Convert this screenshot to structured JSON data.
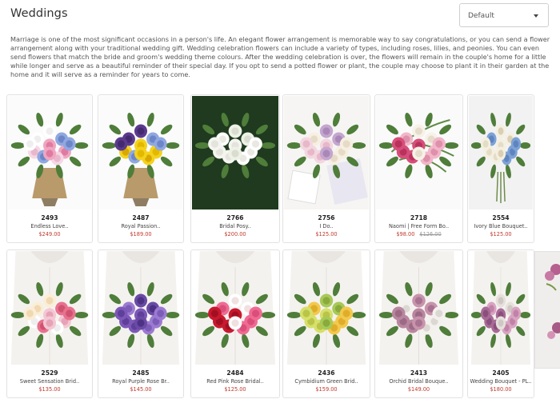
{
  "header": {
    "title": "Weddings",
    "sort": {
      "selected": "Default"
    }
  },
  "intro": "Marriage is one of the most significant occasions in a person's life. An elegant flower arrangement is memorable way to say congratulations, or you can send a flower arrangement along with your traditional wedding gift. Wedding celebration flowers can include a variety of types, including roses, lilies, and peonies. You can even send flowers that match the bride and groom's wedding theme colours. After the wedding celebration is over, the flowers will remain in the couple's home for a little while longer and serve as a beautiful reminder of their special day.  If you opt to send a potted flower or plant, the couple may choose to plant it in their garden at the home and it will serve as a reminder for years to come.",
  "products": [
    {
      "code": "2493",
      "name": "Endless Love..",
      "price": "$249.00",
      "image": "mixed-bouquet-burlap"
    },
    {
      "code": "2487",
      "name": "Royal Passion..",
      "price": "$189.00",
      "image": "purple-yellow-bouquet-burlap"
    },
    {
      "code": "2766",
      "name": "Bridal Posy..",
      "price": "$200.00",
      "image": "white-roses-posy"
    },
    {
      "code": "2756",
      "name": "I Do..",
      "price": "$125.00",
      "image": "pastel-rose-bouquet-card"
    },
    {
      "code": "2718",
      "name": "Naomi | Free Form Bo..",
      "price": "$98.00",
      "old_price": "$126.00",
      "image": "free-form-bouquet"
    },
    {
      "code": "2554",
      "name": "Ivory Blue Bouquet..",
      "price": "$125.00",
      "image": "ivory-blue-bouquet"
    },
    {
      "code": "2529",
      "name": "Sweet Sensation Brid..",
      "price": "$135.00",
      "image": "bride-pastel-rose-bouquet"
    },
    {
      "code": "2485",
      "name": "Royal Purple Rose Br..",
      "price": "$145.00",
      "image": "bride-purple-rose-bouquet"
    },
    {
      "code": "2484",
      "name": "Red Pink Rose Bridal..",
      "price": "$125.00",
      "image": "bride-red-pink-bouquet"
    },
    {
      "code": "2436",
      "name": "Cymbidium Green Brid..",
      "price": "$159.00",
      "image": "bride-green-orchid-bouquet"
    },
    {
      "code": "2413",
      "name": "Orchid Bridal Bouque..",
      "price": "$149.00",
      "image": "bride-orchid-bouquet"
    },
    {
      "code": "2405",
      "name": "Wedding Bouquet - PL..",
      "price": "$180.00",
      "image": "bride-pink-lily-bouquet"
    }
  ],
  "colors": {
    "price": "#c0392b",
    "border": "#e2e2e2",
    "title": "#333333"
  }
}
